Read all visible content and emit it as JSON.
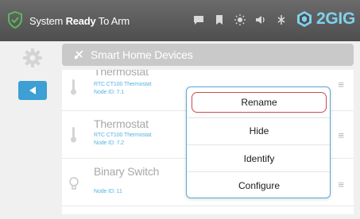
{
  "status_bar": {
    "prefix": "System ",
    "bold_text": "Ready",
    "suffix": " To Arm",
    "icons": [
      "messages-icon",
      "bookmark-icon",
      "brightness-icon",
      "volume-icon",
      "signal-icon"
    ],
    "brand": "2GIG",
    "brand_color": "#7fd1ee",
    "shield_color": "#5cb85c"
  },
  "header": {
    "title": "Smart Home Devices"
  },
  "devices": [
    {
      "name": "Thermostat",
      "model": "RTC CT100 Thermostat",
      "node": "Node ID: 7.1",
      "icon": "thermometer-icon"
    },
    {
      "name": "Thermostat",
      "model": "RTC CT100 Thermostat",
      "node": "Node ID: 7.2",
      "icon": "thermometer-icon"
    },
    {
      "name": "Binary Switch",
      "model": "",
      "node": "Node ID: 11",
      "icon": "lightbulb-icon"
    }
  ],
  "menu": {
    "items": [
      "Rename",
      "Hide",
      "Identify",
      "Configure"
    ],
    "selected_index": 0
  },
  "colors": {
    "accent_blue": "#3d9fd4",
    "selection_red": "#c94a4a"
  }
}
